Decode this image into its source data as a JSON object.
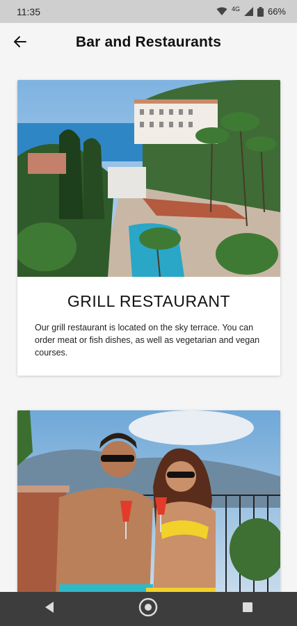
{
  "status_bar": {
    "time": "11:35",
    "network": "4G",
    "battery": "66%",
    "icons": [
      "wifi-icon",
      "signal-icon",
      "battery-icon"
    ]
  },
  "header": {
    "title": "Bar and Restaurants",
    "back_icon": "arrow-left-icon"
  },
  "venues": [
    {
      "title": "GRILL RESTAURANT",
      "description": "Our grill restaurant is located on the sky terrace. You can order meat or fish dishes, as well as vegetarian and vegan courses.",
      "image": "hotel-terrace-pool-photo"
    },
    {
      "title": "",
      "description": "",
      "image": "couple-with-drinks-photo"
    }
  ],
  "nav_bar": {
    "icons": [
      "back-triangle-icon",
      "home-circle-icon",
      "recents-square-icon"
    ]
  },
  "colors": {
    "background": "#f5f5f5",
    "status_bar": "#cfcfcf",
    "nav_bar": "#3d3d3d",
    "card": "#ffffff"
  }
}
